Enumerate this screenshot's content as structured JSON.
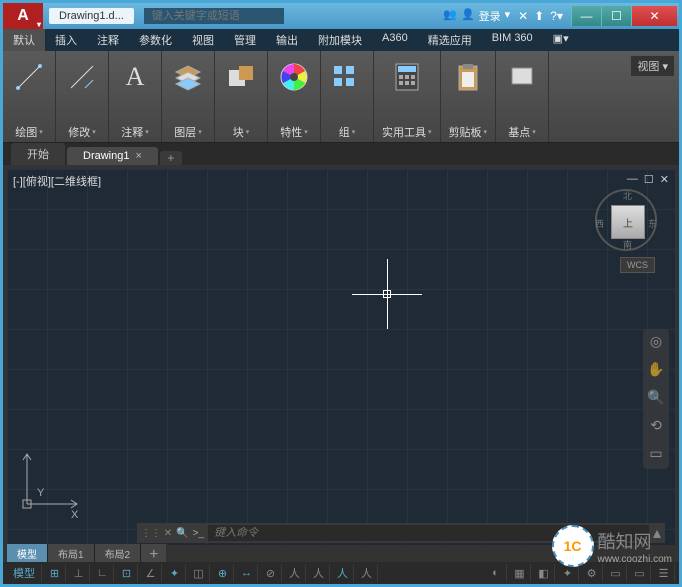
{
  "titlebar": {
    "app_letter": "A",
    "doc_name": "Drawing1.d...",
    "search_placeholder": "键入关键字或短语",
    "login": "登录"
  },
  "menu_tabs": [
    "默认",
    "插入",
    "注释",
    "参数化",
    "视图",
    "管理",
    "输出",
    "附加模块",
    "A360",
    "精选应用",
    "BIM 360"
  ],
  "ribbon_panels": [
    {
      "label": "绘图",
      "icon": "line"
    },
    {
      "label": "修改",
      "icon": "modify"
    },
    {
      "label": "注释",
      "icon": "text"
    },
    {
      "label": "图层",
      "icon": "layers"
    },
    {
      "label": "块",
      "icon": "block"
    },
    {
      "label": "特性",
      "icon": "props"
    },
    {
      "label": "组",
      "icon": "group"
    },
    {
      "label": "实用工具",
      "icon": "util"
    },
    {
      "label": "剪贴板",
      "icon": "clip"
    },
    {
      "label": "基点",
      "icon": "base"
    }
  ],
  "ribbon_view_dd": "视图 ▾",
  "file_tabs": {
    "start": "开始",
    "active": "Drawing1"
  },
  "drawing": {
    "header": "[-][俯视][二维线框]",
    "ucs_y": "Y",
    "ucs_x": "X"
  },
  "viewcube": {
    "top": "上",
    "n": "北",
    "s": "南",
    "e": "东",
    "w": "西",
    "wcs": "WCS"
  },
  "command": {
    "prompt": ">_",
    "placeholder": "键入命令"
  },
  "layout_tabs": [
    "模型",
    "布局1",
    "布局2"
  ],
  "statusbar_items": [
    "模型",
    "⊞",
    "⊥",
    "∟",
    "⊡",
    "∠",
    "✦",
    "◫",
    "⊕",
    "↔",
    "⊘",
    "人",
    "人",
    "人",
    "人",
    "◐",
    "▦",
    "◧",
    "✦",
    "⚙",
    "▭",
    "▭",
    "☰"
  ],
  "watermark": {
    "logo": "1C",
    "text": "酷知网",
    "url": "www.coozhi.com"
  }
}
